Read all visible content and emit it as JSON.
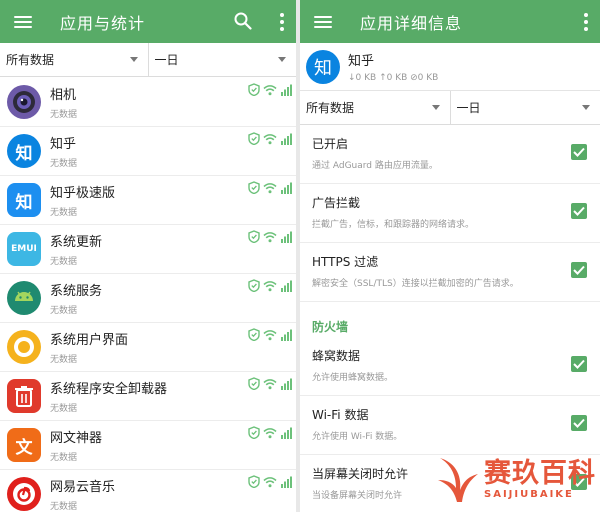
{
  "colors": {
    "accent": "#58ab67",
    "watermark": "#e5573b"
  },
  "left": {
    "title": "应用与统计",
    "filters": {
      "traffic": "所有数据",
      "period": "一日"
    },
    "apps": [
      {
        "name": "相机",
        "sub": "无数据",
        "icon": "camera-icon",
        "color": "#6d5aa8"
      },
      {
        "name": "知乎",
        "sub": "无数据",
        "icon": "zhihu-icon",
        "color": "#0a84e0"
      },
      {
        "name": "知乎极速版",
        "sub": "无数据",
        "icon": "zhihu-lite-icon",
        "color": "#1d8ff0"
      },
      {
        "name": "系统更新",
        "sub": "无数据",
        "icon": "emui-update-icon",
        "color": "#3db7e4"
      },
      {
        "name": "系统服务",
        "sub": "无数据",
        "icon": "android-icon",
        "color": "#1f8a70"
      },
      {
        "name": "系统用户界面",
        "sub": "无数据",
        "icon": "system-ui-icon",
        "color": "#f5b21d"
      },
      {
        "name": "系统程序安全卸载器",
        "sub": "无数据",
        "icon": "uninstaller-icon",
        "color": "#e03a2c"
      },
      {
        "name": "网文神器",
        "sub": "无数据",
        "icon": "wenwen-icon",
        "color": "#f06c18"
      },
      {
        "name": "网易云音乐",
        "sub": "无数据",
        "icon": "netease-music-icon",
        "color": "#e0201c"
      }
    ],
    "icon_glyphs": {
      "zhihu": "知",
      "zhihu_lite": "知",
      "emui": "EMUI",
      "wenwen": "文"
    }
  },
  "right": {
    "title": "应用详细信息",
    "app": {
      "name": "知乎",
      "traffic": "↓0 KB ↑0 KB ⊘0 KB",
      "glyph": "知"
    },
    "filters": {
      "traffic": "所有数据",
      "period": "一日"
    },
    "toggles": [
      {
        "title": "已开启",
        "desc": "通过 AdGuard 路由应用流量。"
      },
      {
        "title": "广告拦截",
        "desc": "拦截广告，信标，和跟踪器的网络请求。"
      },
      {
        "title": "HTTPS 过滤",
        "desc": "解密安全（SSL/TLS）连接以拦截加密的广告请求。"
      }
    ],
    "firewall_section": "防火墙",
    "firewall_toggles": [
      {
        "title": "蜂窝数据",
        "desc": "允许使用蜂窝数据。"
      },
      {
        "title": "Wi-Fi 数据",
        "desc": "允许使用 Wi-Fi 数据。"
      },
      {
        "title": "当屏幕关闭时允许",
        "desc": "当设备屏幕关闭时允许"
      }
    ]
  },
  "watermark": {
    "cn": "赛玖百科",
    "en": "SAIJIUBAIKE"
  }
}
